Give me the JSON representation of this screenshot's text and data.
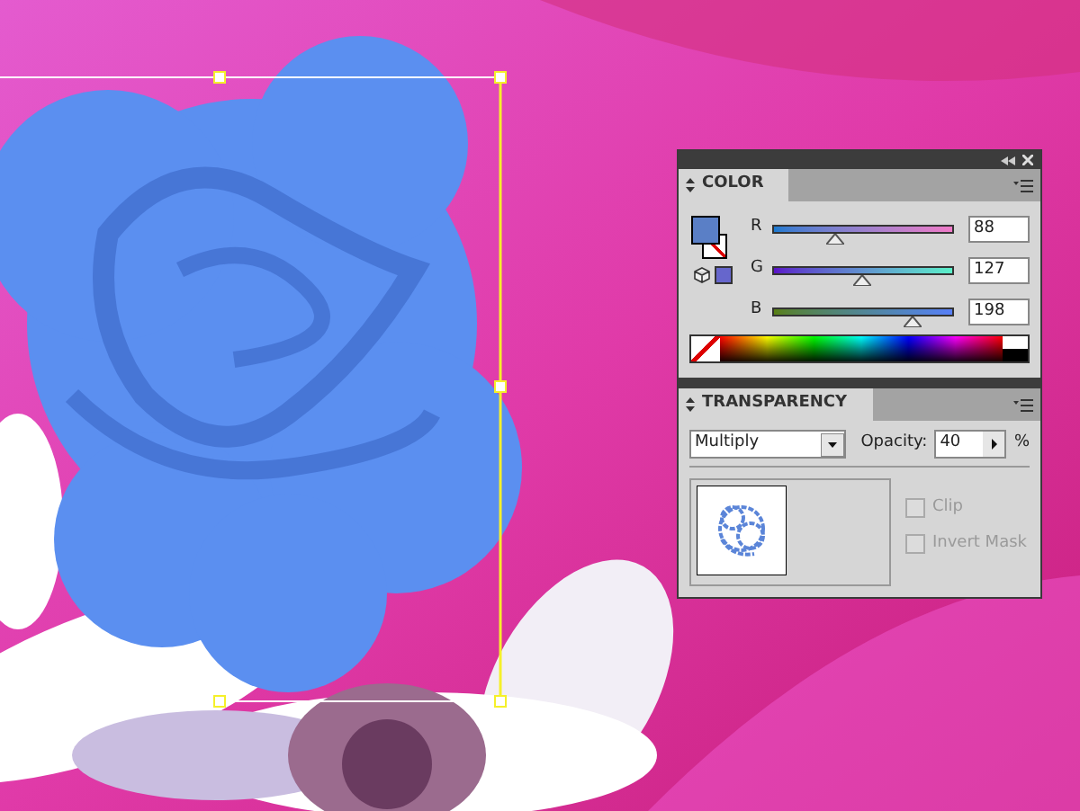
{
  "color_panel": {
    "title": "COLOR",
    "channels": [
      {
        "label": "R",
        "level": 0.345,
        "value": "88"
      },
      {
        "label": "G",
        "level": 0.498,
        "value": "127"
      },
      {
        "label": "B",
        "level": 0.776,
        "value": "198"
      }
    ]
  },
  "transparency_panel": {
    "title": "TRANSPARENCY",
    "blend_mode": "Multiply",
    "opacity_label": "Opacity:",
    "opacity": "40",
    "unit": "%",
    "options": [
      {
        "label": "Clip",
        "checked": false,
        "disabled": true
      },
      {
        "label": "Invert Mask",
        "checked": false,
        "disabled": true
      }
    ]
  }
}
